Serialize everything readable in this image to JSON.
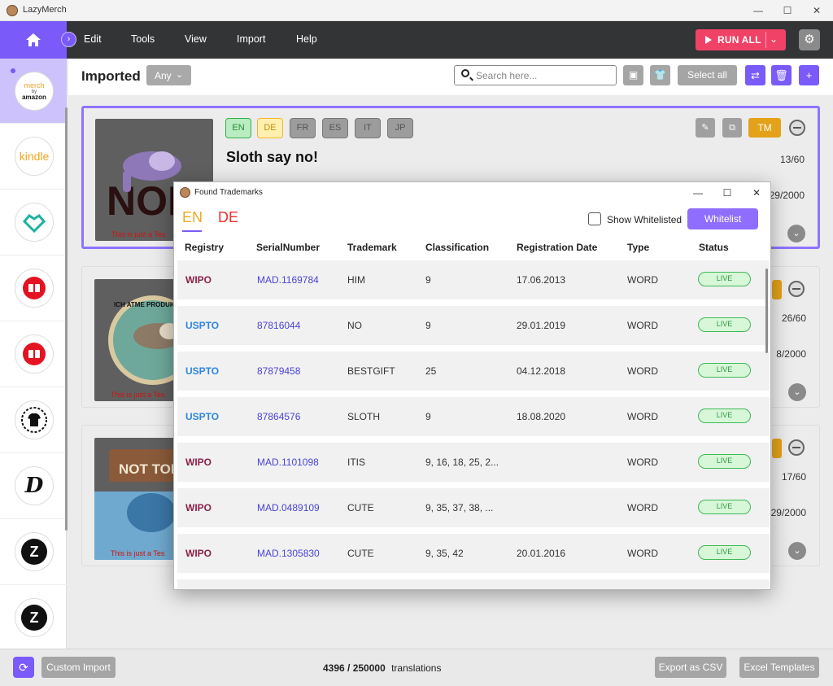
{
  "window": {
    "title": "LazyMerch",
    "minimize": "—",
    "maximize": "☐",
    "close": "✕"
  },
  "menu": {
    "items": [
      "Edit",
      "Tools",
      "View",
      "Import",
      "Help"
    ],
    "run_all": "RUN ALL",
    "settings_icon": "gear-icon"
  },
  "toolbar": {
    "title": "Imported",
    "filter": "Any",
    "search_placeholder": "Search here...",
    "select_all": "Select all"
  },
  "sidebar": {
    "items": [
      {
        "name": "merch-by-amazon",
        "label_top": "merch",
        "label_sub": "by",
        "label_main": "amazon",
        "active": true
      },
      {
        "name": "kindle",
        "label": "kindle"
      },
      {
        "name": "teepublic",
        "label": ""
      },
      {
        "name": "redbubble-1",
        "label": ""
      },
      {
        "name": "redbubble-2",
        "label": ""
      },
      {
        "name": "shirt-shop",
        "label": ""
      },
      {
        "name": "displate",
        "label": "D"
      },
      {
        "name": "zazzle-1",
        "label": "Z"
      },
      {
        "name": "zazzle-2",
        "label": "Z"
      }
    ]
  },
  "cards": [
    {
      "title": "Sloth say no!",
      "count": "13/60",
      "date": "29/2000",
      "thumb_caption": "This is just a Tes",
      "thumb_text": "NOPE",
      "langs": [
        "EN",
        "DE",
        "FR",
        "ES",
        "IT",
        "JP"
      ],
      "tm": "TM"
    },
    {
      "count": "26/60",
      "date": "8/2000",
      "thumb_caption": "This is just a Tes",
      "thumb_text": "ICH ATME PRODUKTIV"
    },
    {
      "count": "17/60",
      "date": "29/2000",
      "thumb_caption": "This is just a Tes",
      "thumb_text": "NOT TODAY"
    }
  ],
  "footer": {
    "custom_import": "Custom Import",
    "translations_used": "4396 / 250000",
    "translations_label": "translations",
    "export_csv": "Export as CSV",
    "excel_templates": "Excel Templates"
  },
  "modal": {
    "title": "Found Trademarks",
    "lang_en": "EN",
    "lang_de": "DE",
    "show_whitelisted": "Show Whitelisted",
    "whitelist_button": "Whitelist",
    "headers": [
      "Registry",
      "SerialNumber",
      "Trademark",
      "Classification",
      "Registration Date",
      "Type",
      "Status"
    ],
    "rows": [
      {
        "registry": "WIPO",
        "serial": "MAD.1169784",
        "trademark": "HIM",
        "classification": "9",
        "date": "17.06.2013",
        "type": "WORD",
        "status": "LIVE"
      },
      {
        "registry": "USPTO",
        "serial": "87816044",
        "trademark": "NO",
        "classification": "9",
        "date": "29.01.2019",
        "type": "WORD",
        "status": "LIVE"
      },
      {
        "registry": "USPTO",
        "serial": "87879458",
        "trademark": "BESTGIFT",
        "classification": "25",
        "date": "04.12.2018",
        "type": "WORD",
        "status": "LIVE"
      },
      {
        "registry": "USPTO",
        "serial": "87864576",
        "trademark": "SLOTH",
        "classification": "9",
        "date": "18.08.2020",
        "type": "WORD",
        "status": "LIVE"
      },
      {
        "registry": "WIPO",
        "serial": "MAD.1101098",
        "trademark": "ITIS",
        "classification": "9, 16, 18, 25, 2...",
        "date": "",
        "type": "WORD",
        "status": "LIVE"
      },
      {
        "registry": "WIPO",
        "serial": "MAD.0489109",
        "trademark": "CUTE",
        "classification": "9, 35, 37, 38, ...",
        "date": "",
        "type": "WORD",
        "status": "LIVE"
      },
      {
        "registry": "WIPO",
        "serial": "MAD.1305830",
        "trademark": "CUTE",
        "classification": "9, 35, 42",
        "date": "20.01.2016",
        "type": "WORD",
        "status": "LIVE"
      }
    ]
  }
}
